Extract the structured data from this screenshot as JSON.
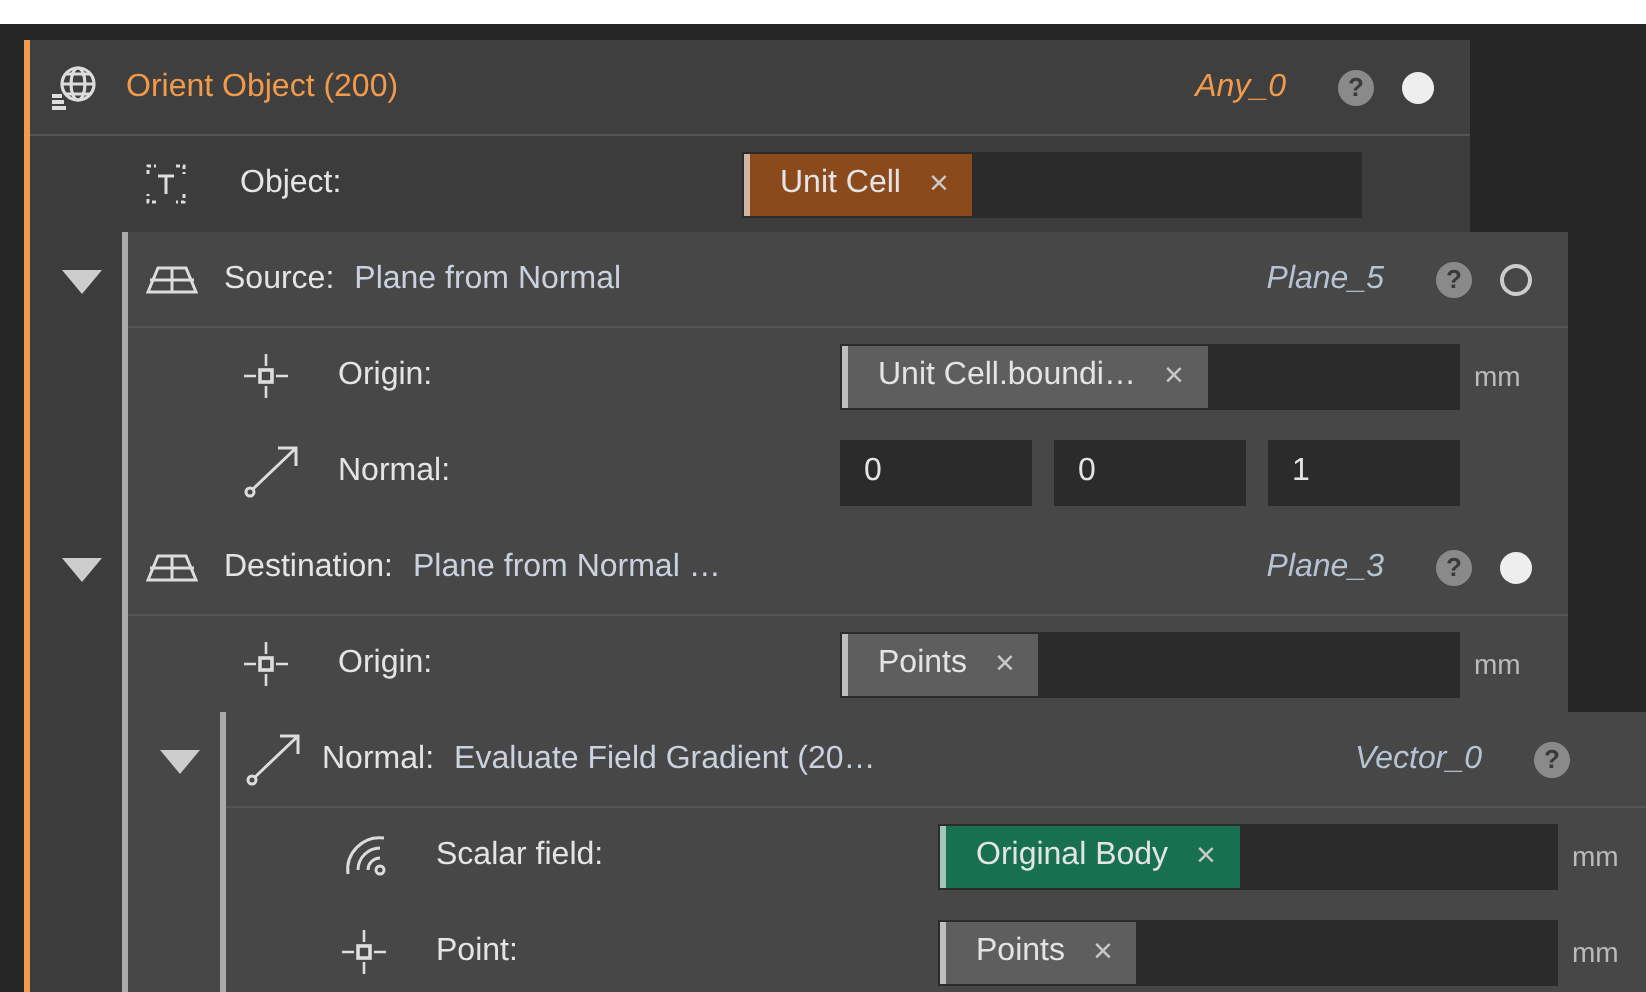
{
  "node": {
    "kind": "any",
    "title": "Orient Object (200)",
    "output": "Any_0",
    "help": "?",
    "active": true,
    "inputs": [
      {
        "kind": "object",
        "label": "Object:",
        "tags": [
          {
            "text": "Unit Cell",
            "remove": "×",
            "color": "#8a4a1c"
          }
        ]
      },
      {
        "kind": "plane",
        "label": "Source:",
        "value": "Plane from Normal",
        "output": "Plane_5",
        "help": "?",
        "active": false,
        "expanded": true,
        "inputs": [
          {
            "kind": "point",
            "label": "Origin:",
            "tags": [
              {
                "text": "Unit Cell.boundi…",
                "remove": "×",
                "color": "#5e5e5e"
              }
            ],
            "unit": "mm"
          },
          {
            "kind": "vector",
            "label": "Normal:",
            "values": [
              "0",
              "0",
              "1"
            ]
          }
        ]
      },
      {
        "kind": "plane",
        "label": "Destination:",
        "value": "Plane from Normal …",
        "output": "Plane_3",
        "help": "?",
        "active": true,
        "expanded": true,
        "inputs": [
          {
            "kind": "point",
            "label": "Origin:",
            "tags": [
              {
                "text": "Points",
                "remove": "×",
                "color": "#5e5e5e"
              }
            ],
            "unit": "mm"
          },
          {
            "kind": "vector",
            "label": "Normal:",
            "value": "Evaluate Field Gradient (20…",
            "output": "Vector_0",
            "help": "?",
            "expanded": true,
            "inputs": [
              {
                "kind": "scalar_field",
                "label": "Scalar field:",
                "tags": [
                  {
                    "text": "Original Body",
                    "remove": "×",
                    "color": "#17704f"
                  }
                ],
                "unit": "mm"
              },
              {
                "kind": "point",
                "label": "Point:",
                "tags": [
                  {
                    "text": "Points",
                    "remove": "×",
                    "color": "#5e5e5e"
                  }
                ],
                "unit": "mm"
              }
            ]
          }
        ]
      }
    ]
  }
}
